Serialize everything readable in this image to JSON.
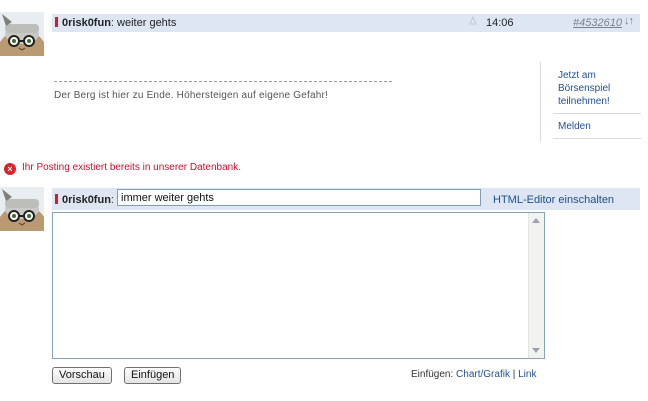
{
  "post": {
    "username": "0risk0fun",
    "separator": ":",
    "title": "weiter gehts",
    "time": "14:06",
    "id": "#4532610",
    "sort_arrows": "↓↑",
    "signature": "Der Berg ist hier zu Ende. Höhersteigen auf eigene Gefahr!"
  },
  "sidebar": {
    "boersenspiel_line1": "Jetzt am",
    "boersenspiel_line2": "Börsenspiel",
    "boersenspiel_line3": "teilnehmen!",
    "report_label": "Melden"
  },
  "error": {
    "icon": "×",
    "message": "Ihr Posting existiert bereits in unserer Datenbank."
  },
  "reply_form": {
    "username": "0risk0fun",
    "separator": ":",
    "title_value": "immer weiter gehts",
    "html_editor_label": "HTML-Editor einschalten",
    "body_value": "",
    "preview_label": "Vorschau",
    "insert_label": "Einfügen",
    "insert_prefix": "Einfügen:",
    "chart_link": "Chart/Grafik",
    "link_sep": "|",
    "link_label": "Link"
  },
  "colors": {
    "bar_bg": "#dde6f2",
    "link": "#1f4f8f",
    "error": "#c8102e",
    "user_mark": "#d21f26"
  },
  "icons": {
    "avatar": "cat-with-glasses-avatar",
    "error": "error-x-circle-icon",
    "rating": "rating-icon",
    "sort": "sort-arrows-icon"
  }
}
